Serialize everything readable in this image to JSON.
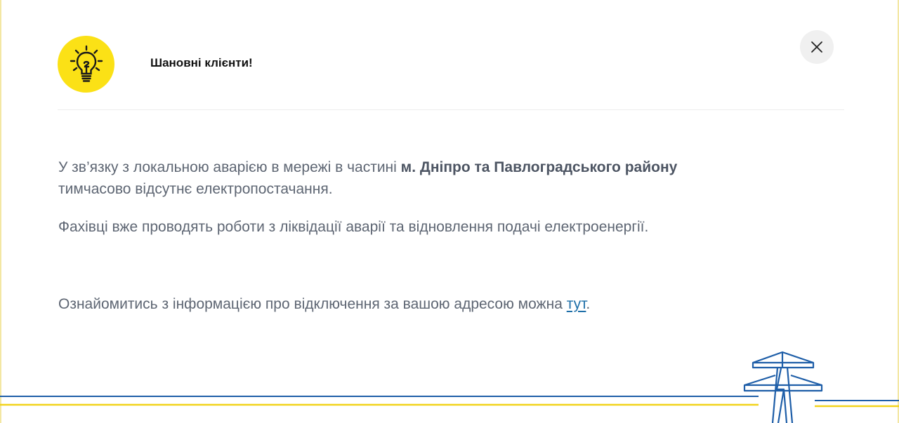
{
  "modal": {
    "title": "Шановні клієнти!",
    "close_icon": "close-icon",
    "header_icon": "lightbulb-icon",
    "paragraph1": {
      "text_before": "У зв’язку з локальною аварією в мережі в частині ",
      "bold": "м. Дніпро та Павлоградського району",
      "line2": "тимчасово відсутнє електропостачання."
    },
    "paragraph2": "Фахівці вже проводять роботи з ліквідації аварії та відновлення подачі електроенергії.",
    "paragraph3": {
      "text_before": "Ознайомитись з інформацією про відключення за вашою адресою можна ",
      "link_text": "тут",
      "text_after": "."
    }
  },
  "decoration": {
    "footer_icon": "power-tower-icon"
  },
  "colors": {
    "accent_yellow": "#fbe116",
    "blue": "#1e5ea8",
    "text": "#5e6673",
    "link": "#1e6fa8"
  }
}
